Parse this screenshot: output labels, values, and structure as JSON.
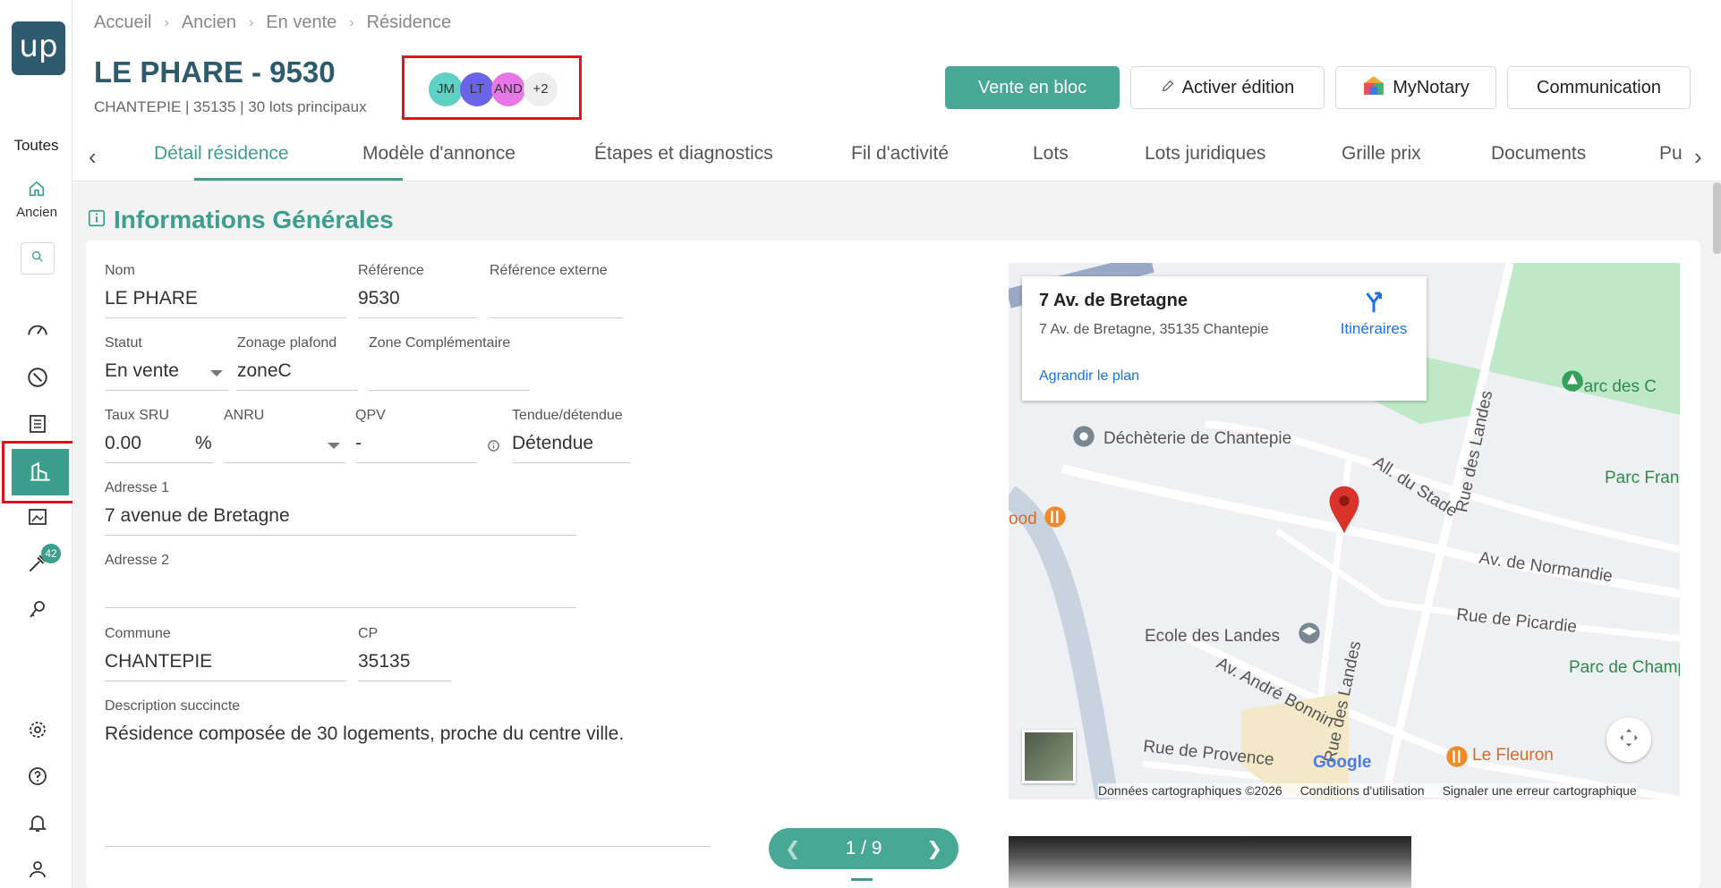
{
  "sidebar": {
    "logo": "up",
    "scope_label": "Toutes",
    "home_label": "Ancien",
    "notifications_badge": "42",
    "icons": [
      "home-icon",
      "search-icon",
      "dashboard-icon",
      "compass-icon",
      "list-icon",
      "residence-icon",
      "gallery-icon",
      "tools-icon",
      "keys-icon",
      "settings-icon",
      "help-icon",
      "bell-icon",
      "user-icon"
    ]
  },
  "breadcrumb": [
    "Accueil",
    "Ancien",
    "En vente",
    "Résidence"
  ],
  "header": {
    "title": "LE PHARE - 9530",
    "subtitle": "CHANTEPIE | 35135 | 30 lots principaux",
    "avatars": [
      {
        "initials": "JM",
        "color": "#5fd0c4"
      },
      {
        "initials": "LT",
        "color": "#6b63e8"
      },
      {
        "initials": "AND",
        "color": "#e777e6"
      },
      {
        "initials": "+2",
        "color": "#eeeeee"
      }
    ],
    "actions": {
      "vente_bloc": "Vente en bloc",
      "activer_edition": "Activer édition",
      "mynotary": "MyNotary",
      "communication": "Communication"
    }
  },
  "tabs": [
    "Détail résidence",
    "Modèle d'annonce",
    "Étapes et diagnostics",
    "Fil d'activité",
    "Lots",
    "Lots juridiques",
    "Grille prix",
    "Documents",
    "Pu"
  ],
  "section": {
    "title": "Informations Générales"
  },
  "form": {
    "nom": {
      "label": "Nom",
      "value": "LE PHARE"
    },
    "reference": {
      "label": "Référence",
      "value": "9530"
    },
    "reference_externe": {
      "label": "Référence externe",
      "value": ""
    },
    "statut": {
      "label": "Statut",
      "value": "En vente"
    },
    "zonage": {
      "label": "Zonage plafond",
      "value": "zoneC"
    },
    "zone_comp": {
      "label": "Zone Complémentaire",
      "value": ""
    },
    "taux_sru": {
      "label": "Taux SRU",
      "value": "0.00",
      "unit": "%"
    },
    "anru": {
      "label": "ANRU",
      "value": ""
    },
    "qpv": {
      "label": "QPV",
      "value": "-"
    },
    "tendue": {
      "label": "Tendue/détendue",
      "value": "Détendue"
    },
    "adresse1": {
      "label": "Adresse 1",
      "value": "7 avenue de Bretagne"
    },
    "adresse2": {
      "label": "Adresse 2",
      "value": ""
    },
    "commune": {
      "label": "Commune",
      "value": "CHANTEPIE"
    },
    "cp": {
      "label": "CP",
      "value": "35135"
    },
    "description": {
      "label": "Description succincte",
      "value": "Résidence composée de 30 logements, proche du centre ville."
    }
  },
  "map": {
    "card_title": "7 Av. de Bretagne",
    "card_address": "7 Av. de Bretagne, 35135 Chantepie",
    "directions": "Itinéraires",
    "enlarge": "Agrandir le plan",
    "labels": [
      "Déchèterie de Chantepie",
      "All. du Stade",
      "Rue des Landes",
      "Av. de Normandie",
      "Rue de Picardie",
      "Ecole des Landes",
      "Av. André Bonnin",
      "Rue de Provence",
      "Le Fleuron",
      "Parc des C",
      "Parc Fran",
      "Parc de Champ",
      "ood",
      "Rue des Landes",
      "Google"
    ],
    "footer": [
      "Données cartographiques ©2026",
      "Conditions d'utilisation",
      "Signaler une erreur cartographique"
    ]
  },
  "pager": {
    "text": "1 / 9"
  }
}
